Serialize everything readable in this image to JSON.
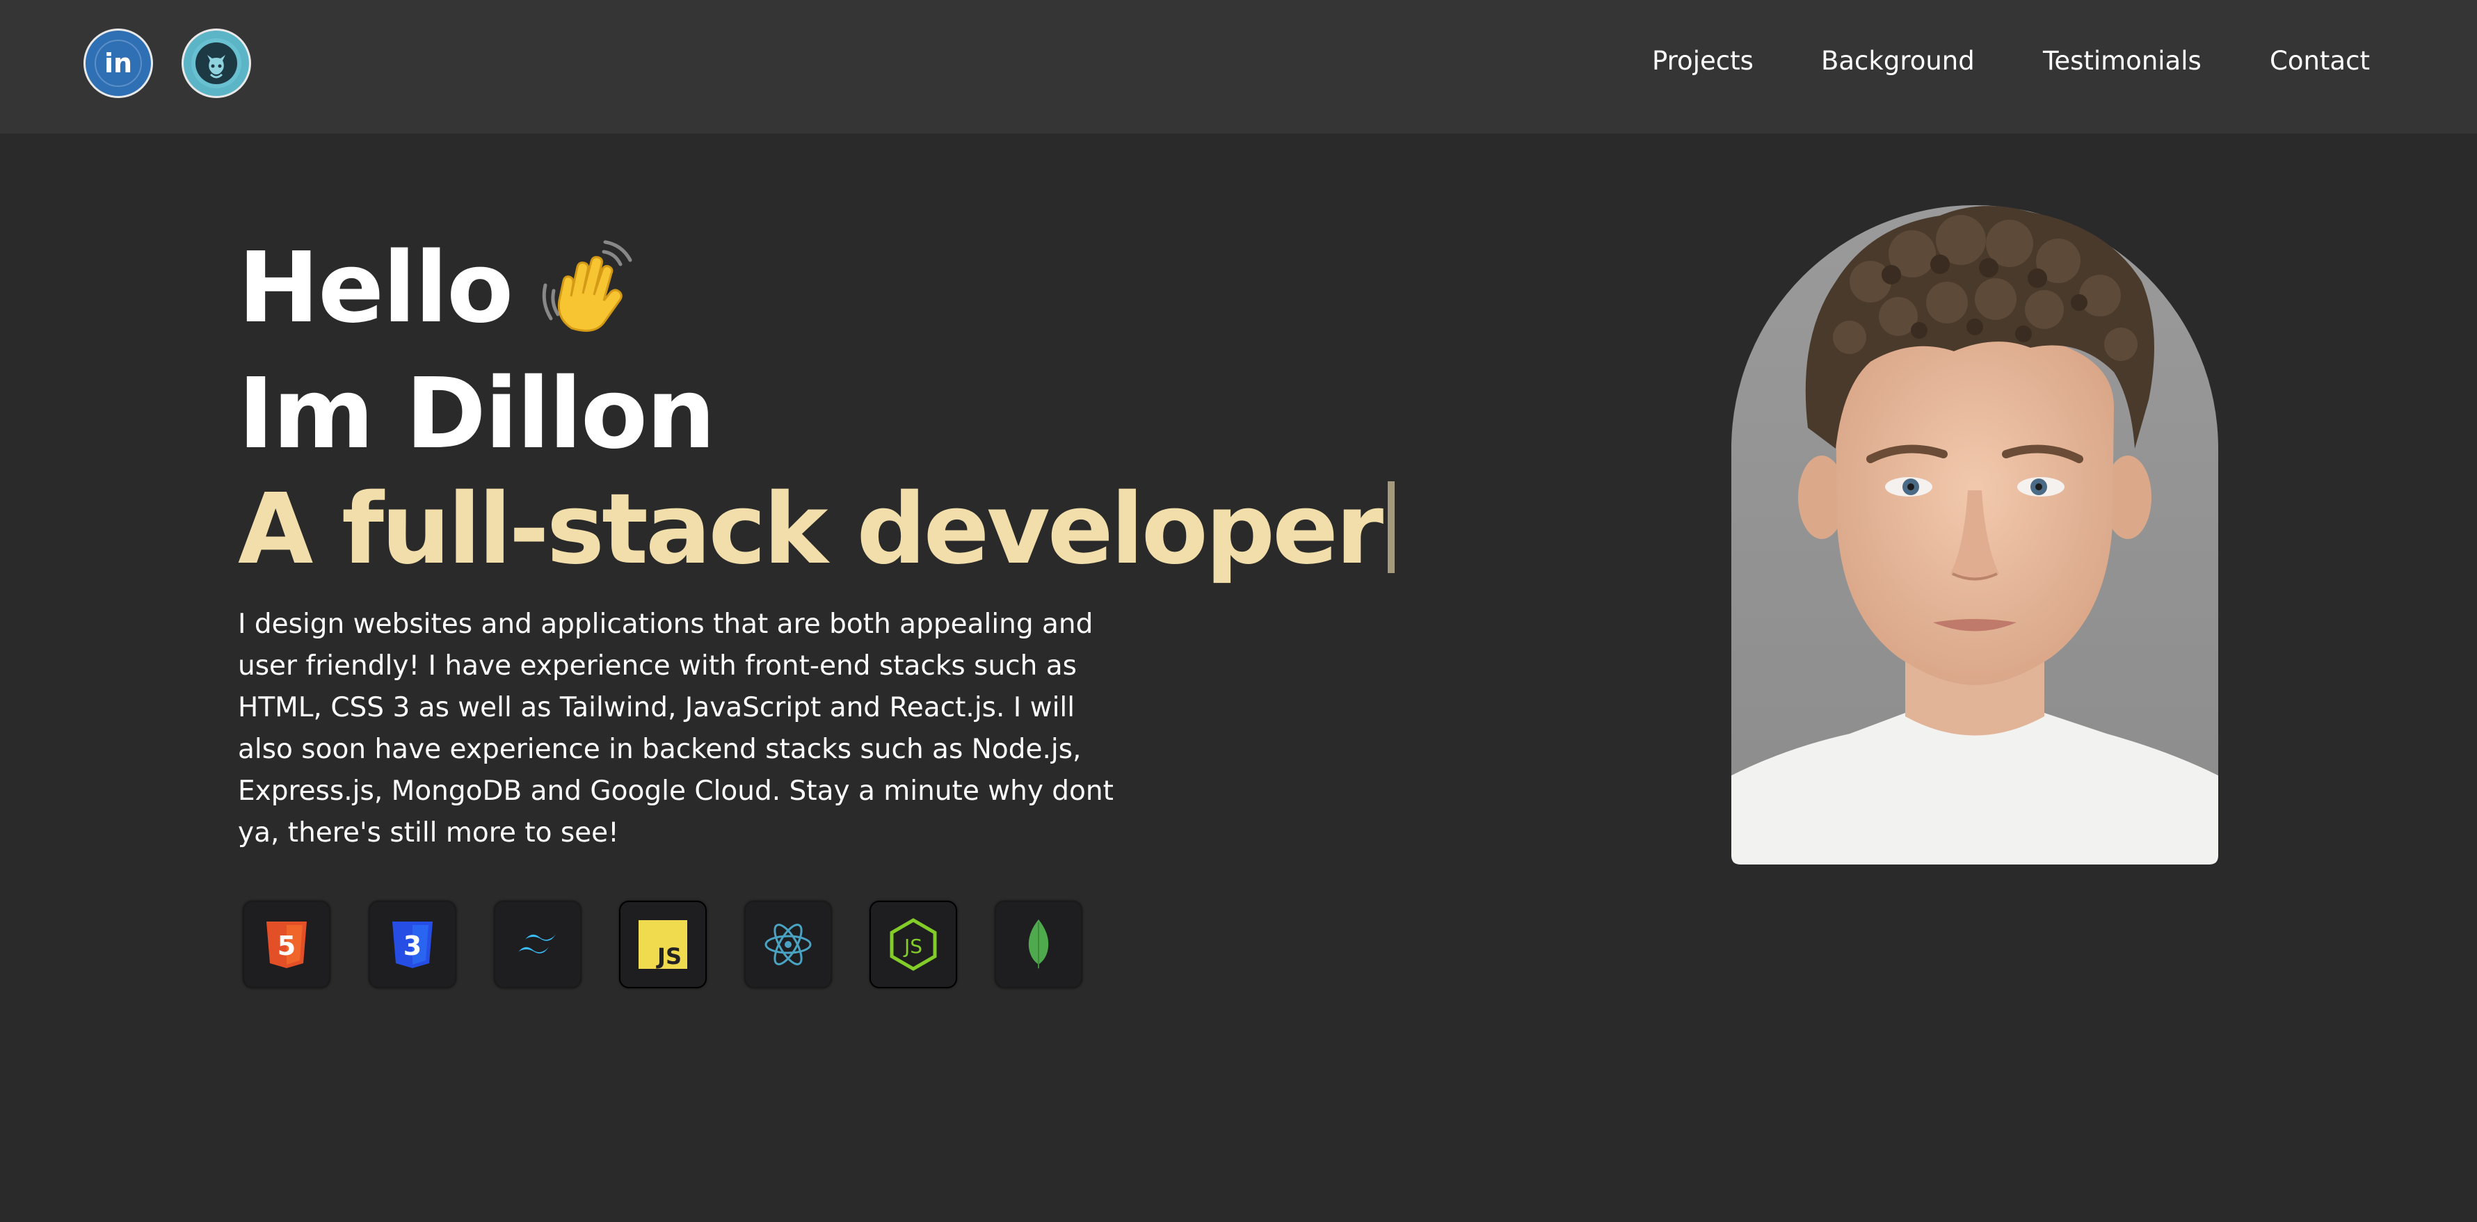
{
  "header": {
    "socials": [
      {
        "name": "linkedin",
        "icon": "linkedin-icon",
        "glyph": "in"
      },
      {
        "name": "github",
        "icon": "github-icon"
      }
    ],
    "nav": [
      "Projects",
      "Background",
      "Testimonials",
      "Contact"
    ]
  },
  "hero": {
    "hello": "Hello",
    "wave_icon": "waving-hand-icon",
    "name": "Im Dillon",
    "role": "A full-stack developer",
    "intro": "I design websites and applications that are both appealing and user friendly! I have experience with front-end stacks such as HTML, CSS 3 as well as Tailwind, JavaScript and React.js. I will also soon have experience in backend stacks such as Node.js, Express.js, MongoDB and Google Cloud. Stay a minute why dont ya, there's still more to see!"
  },
  "tech_stack": [
    {
      "icon": "html5-icon",
      "label": "5"
    },
    {
      "icon": "css3-icon",
      "label": "3"
    },
    {
      "icon": "tailwind-icon"
    },
    {
      "icon": "javascript-icon",
      "label": "JS"
    },
    {
      "icon": "react-icon"
    },
    {
      "icon": "nodejs-icon",
      "label": "JS"
    },
    {
      "icon": "mongodb-icon"
    }
  ],
  "portrait": {
    "icon": "profile-photo"
  },
  "colors": {
    "background": "#2a2a2a",
    "header": "#353535",
    "accent": "#f1deaa",
    "text": "#ffffff"
  }
}
